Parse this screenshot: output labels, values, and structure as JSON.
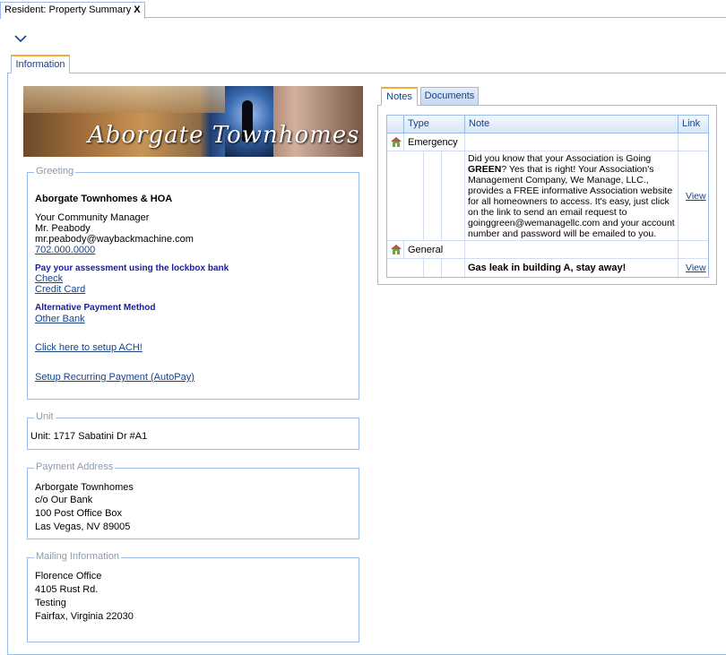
{
  "window_tab": {
    "title": "Resident: Property Summary",
    "close": "X"
  },
  "info_tab": {
    "label": "Information"
  },
  "banner": {
    "title": "Aborgate Townhomes"
  },
  "greeting": {
    "legend": "Greeting",
    "name": "Aborgate Townhomes & HOA",
    "manager_label": "Your Community Manager",
    "manager_name": "Mr. Peabody",
    "manager_email": "mr.peabody@waybackmachine.com",
    "phone": "702.000.0000",
    "lockbox_label": "Pay your assessment using the lockbox bank",
    "check": "Check",
    "credit_card": "Credit Card",
    "alt_label": "Alternative Payment Method",
    "other_bank": "Other Bank",
    "ach": "Click here to setup ACH!",
    "autopay": "Setup Recurring Payment (AutoPay)"
  },
  "unit": {
    "legend": "Unit",
    "text": "Unit:  1717 Sabatini Dr #A1"
  },
  "payment_address": {
    "legend": "Payment Address",
    "lines": [
      "Arborgate Townhomes",
      "c/o Our Bank",
      "100 Post Office Box",
      "Las Vegas, NV 89005"
    ]
  },
  "mailing": {
    "legend": "Mailing Information",
    "lines": [
      "Florence Office",
      "4105 Rust Rd.",
      "Testing",
      "Fairfax, Virginia 22030"
    ]
  },
  "notes_tabs": {
    "notes": "Notes",
    "documents": "Documents"
  },
  "grid": {
    "headers": {
      "type": "Type",
      "note": "Note",
      "link": "Link"
    },
    "groups": [
      {
        "type": "Emergency",
        "note_parts": [
          "Did you know that your Association is Going ",
          "GREEN",
          "? Yes that is right! Your Association's Management Company, We Manage, LLC., provides a FREE informative Association website for all homeowners to access. It's easy, just click on the link to send an email request to goinggreen@wemanagellc.com and your account number and password will be emailed to you."
        ],
        "link": "View"
      },
      {
        "type": "General",
        "note": "Gas leak in building A, stay away!",
        "link": "View"
      }
    ]
  }
}
